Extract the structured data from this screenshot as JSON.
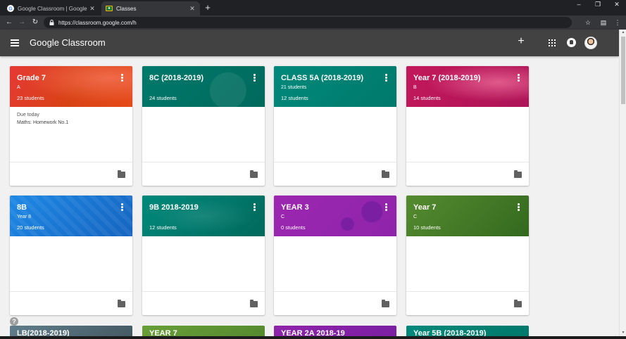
{
  "browser": {
    "tabs": [
      {
        "title": "Google Classroom | Google for E",
        "active": false
      },
      {
        "title": "Classes",
        "active": true
      }
    ],
    "new_tab": "+",
    "url": "https://classroom.google.com/h",
    "window_controls": {
      "minimize": "–",
      "maximize": "❐",
      "close": "✕"
    }
  },
  "appbar": {
    "brand": "Google Classroom",
    "add_label": "+"
  },
  "colors": {
    "red": "#e53935",
    "teal": "#00796b",
    "crimson": "#c2185b",
    "blue": "#1e88e5",
    "purple": "#9c27b0",
    "green": "#558b2f"
  },
  "classes": [
    {
      "title": "Grade 7",
      "section": "A",
      "students": "23 students",
      "due_label": "Due today",
      "due_item": "Maths: Homework No.1"
    },
    {
      "title": "8C (2018-2019)",
      "section": "",
      "students": "24 students"
    },
    {
      "title": "CLASS 5A (2018-2019)",
      "section": "21 students",
      "students": "12 students"
    },
    {
      "title": "Year 7 (2018-2019)",
      "section": "B",
      "students": "14 students"
    },
    {
      "title": "8B",
      "section": "Year 8",
      "students": "20 students"
    },
    {
      "title": "9B 2018-2019",
      "section": "",
      "students": "12 students"
    },
    {
      "title": "YEAR 3",
      "section": "C",
      "students": "0 students"
    },
    {
      "title": "Year 7",
      "section": "C",
      "students": "10 students"
    }
  ],
  "peek_classes": [
    {
      "title": "LB(2018-2019)"
    },
    {
      "title": "YEAR 7"
    },
    {
      "title": "YEAR 2A 2018-19"
    },
    {
      "title": "Year 5B (2018-2019)"
    }
  ],
  "help": "?"
}
